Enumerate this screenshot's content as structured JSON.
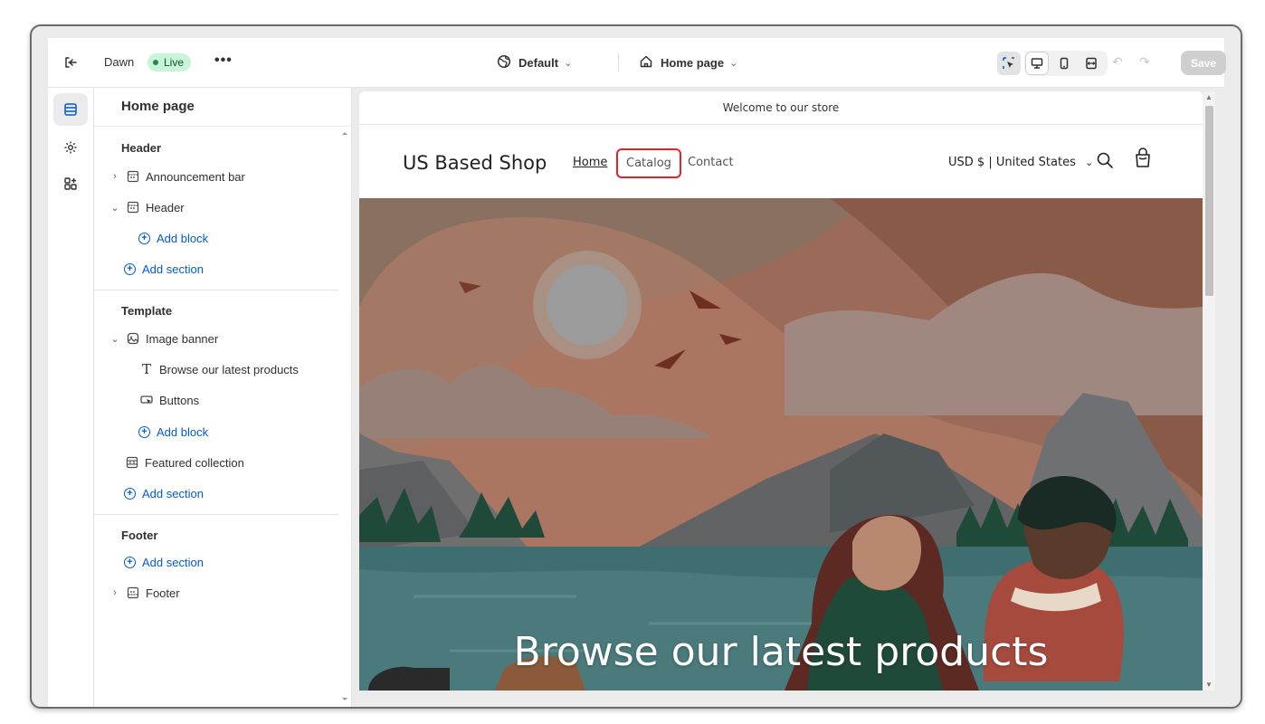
{
  "topbar": {
    "theme_name": "Dawn",
    "status_badge": "Live",
    "more": "•••",
    "preset": "Default",
    "page_selector": "Home page",
    "save_label": "Save"
  },
  "sidebar": {
    "title": "Home page",
    "groups": {
      "header": "Header",
      "template": "Template",
      "footer": "Footer"
    },
    "items": {
      "announcement_bar": "Announcement bar",
      "header": "Header",
      "add_block_1": "Add block",
      "add_section_1": "Add section",
      "image_banner": "Image banner",
      "browse_text": "Browse our latest products",
      "buttons": "Buttons",
      "add_block_2": "Add block",
      "featured_collection": "Featured collection",
      "add_section_2": "Add section",
      "add_section_3": "Add section",
      "footer": "Footer"
    }
  },
  "store": {
    "announcement": "Welcome to our store",
    "shop_name": "US Based Shop",
    "nav": [
      "Home",
      "Catalog",
      "Contact"
    ],
    "currency": "USD $ | United States",
    "banner_heading": "Browse our latest products"
  },
  "colors": {
    "accent_blue": "#005bd3",
    "live_green": "#c9f5d7",
    "highlight_red": "#e4222b"
  }
}
